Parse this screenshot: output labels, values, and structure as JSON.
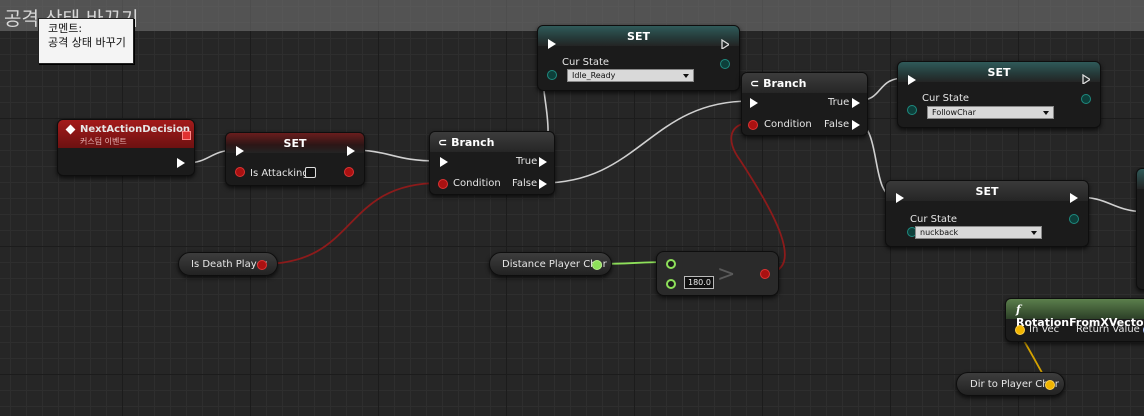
{
  "comment": {
    "title": "공격 상태 바꾸기",
    "tooltip_line1": "코멘트:",
    "tooltip_line2": "공격 상태 바꾸기"
  },
  "nodes": {
    "event": {
      "title": "NextActionDecision",
      "subtitle": "커스텀 이벤트"
    },
    "set_attacking": {
      "title": "SET",
      "var_label": "Is Attacking",
      "value": false
    },
    "branch1": {
      "title": "Branch",
      "true_label": "True",
      "false_label": "False",
      "condition_label": "Condition"
    },
    "set_idle": {
      "title": "SET",
      "var_label": "Cur State",
      "value": "Idle_Ready"
    },
    "branch2": {
      "title": "Branch",
      "true_label": "True",
      "false_label": "False",
      "condition_label": "Condition"
    },
    "set_follow": {
      "title": "SET",
      "var_label": "Cur State",
      "value": "FollowChar"
    },
    "set_nuck": {
      "title": "SET",
      "var_label": "Cur State",
      "value": "nuckback"
    },
    "is_death": {
      "label": "Is Death Player"
    },
    "distance": {
      "label": "Distance Player Char"
    },
    "compare": {
      "value": "180.0",
      "operator": ">"
    },
    "rotation": {
      "title": "RotationFromXVector",
      "icon": "f",
      "in_label": "In Vec",
      "out_label": "Return Value"
    },
    "dir": {
      "label": "Dir to Player Char"
    }
  },
  "colors": {
    "exec_wire": "#d8d8d8",
    "bool_wire": "#8c1b1b",
    "float_wire": "#8ee05a",
    "vector_wire": "#d4a200",
    "event_header": "#a41b1b",
    "set_header_teal": "#2f5a59",
    "function_header": "#5b7f4c"
  }
}
